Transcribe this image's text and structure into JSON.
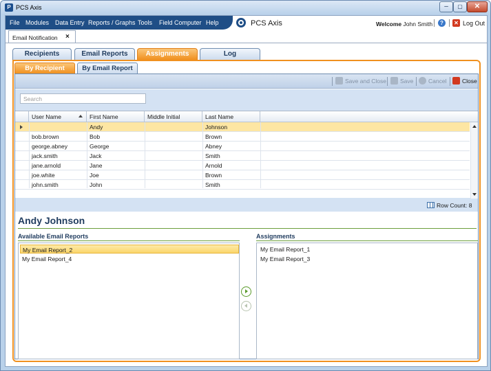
{
  "window": {
    "title": "PCS Axis",
    "logo_letter": "P"
  },
  "menu": [
    "File",
    "Modules",
    "Data Entry",
    "Reports / Graphs",
    "Tools",
    "Field Computer",
    "Help"
  ],
  "brand": {
    "name": "PCS Axis"
  },
  "user": {
    "welcome_label": "Welcome",
    "name": "John Smith",
    "logout_label": "Log Out"
  },
  "doc_tab": {
    "label": "Email Notification"
  },
  "tabs": [
    {
      "label": "Recipients",
      "active": false
    },
    {
      "label": "Email Reports",
      "active": false
    },
    {
      "label": "Assignments",
      "active": true
    },
    {
      "label": "Log",
      "active": false
    }
  ],
  "subtabs": [
    {
      "label": "By Recipient",
      "active": true
    },
    {
      "label": "By Email Report",
      "active": false
    }
  ],
  "toolbar": {
    "save_close": "Save and Close",
    "save": "Save",
    "cancel": "Cancel",
    "close": "Close"
  },
  "search": {
    "placeholder": "Search"
  },
  "grid": {
    "columns": [
      "User Name",
      "First Name",
      "Middle Initial",
      "Last Name"
    ],
    "rows": [
      {
        "user": "",
        "first": "Andy",
        "middle": "",
        "last": "Johnson",
        "selected": true
      },
      {
        "user": "bob.brown",
        "first": "Bob",
        "middle": "",
        "last": "Brown"
      },
      {
        "user": "george.abney",
        "first": "George",
        "middle": "",
        "last": "Abney"
      },
      {
        "user": "jack.smith",
        "first": "Jack",
        "middle": "",
        "last": "Smith"
      },
      {
        "user": "jane.arnold",
        "first": "Jane",
        "middle": "",
        "last": "Arnold"
      },
      {
        "user": "joe.white",
        "first": "Joe",
        "middle": "",
        "last": "Brown"
      },
      {
        "user": "john.smith",
        "first": "John",
        "middle": "",
        "last": "Smith"
      }
    ],
    "row_count_label": "Row Count: 8"
  },
  "detail": {
    "name": "Andy Johnson",
    "available_label": "Available Email Reports",
    "assignments_label": "Assignments",
    "available": [
      {
        "label": "My Email Report_2",
        "selected": true
      },
      {
        "label": "My Email Report_4",
        "selected": false
      }
    ],
    "assigned": [
      {
        "label": "My Email Report_1",
        "selected": false
      },
      {
        "label": "My Email Report_3",
        "selected": false
      }
    ]
  },
  "colors": {
    "accent": "#f0901f",
    "nav": "#1f4e86",
    "selection": "#fde6a3",
    "green": "#6b9e3a"
  }
}
